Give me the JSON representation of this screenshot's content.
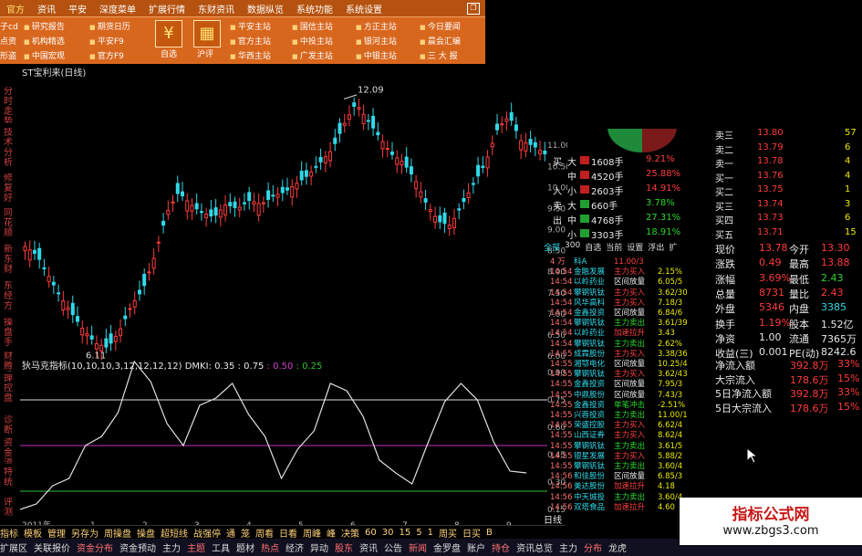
{
  "menu": {
    "top": [
      "官方",
      "资讯",
      "平安",
      "深度菜单",
      "扩展行情",
      "东财资讯",
      "数据纵览",
      "系统功能",
      "系统设置"
    ],
    "left_col": [
      "子cd",
      "点资",
      "形盗"
    ],
    "groups": [
      [
        "研究报告",
        "机构精选",
        "中国宏观"
      ],
      [
        "期货日历",
        "平安F9",
        "官方F9"
      ],
      [
        "平安主站",
        "官方主站",
        "华西主站"
      ],
      [
        "国信主站",
        "中投主站",
        "广发主站"
      ],
      [
        "方正主站",
        "银河主站",
        "中银主站"
      ],
      [
        "今日要闻",
        "晨会汇编",
        "三 大 报"
      ]
    ],
    "icon1": {
      "glyph": "¥",
      "label": "自选"
    },
    "icon2": {
      "glyph": "▦",
      "label": "沪评"
    }
  },
  "left_labels": [
    "分时走势",
    "技术分析",
    "修复好",
    "同花顺",
    "新东财",
    "东经方",
    "操盘手",
    "财腾手",
    "理财王",
    "控盘",
    "诊断",
    "资金流",
    "特统",
    "评测"
  ],
  "chart": {
    "title": "ST宝利来(日线)",
    "indicator_title": "狄马克指标(10,10,10,3,12,12,12,12)",
    "dmki_label": "DMKI: 0.35",
    "dmki_v2": ": 0.75",
    "dmki_v3": ": 0.50",
    "dmki_v4": ": 0.25",
    "high_label": "12.09",
    "low_label": "6.11",
    "x_ticks": [
      "2011年",
      "1",
      "2",
      "3",
      "4",
      "5",
      "6",
      "7",
      "8",
      "9"
    ],
    "y_ticks_price": [
      "11.00",
      "10.50",
      "10.00",
      "9.50",
      "9.00",
      "8.50",
      "8.00",
      "7.50",
      "7.00",
      "6.50",
      "6.00"
    ],
    "y_ticks_ind": [
      "0.90",
      "0.75",
      "0.60",
      "0.45",
      "0.30",
      "0.15"
    ],
    "period": "日线"
  },
  "chart_data": {
    "type": "line",
    "title": "ST宝利来(日线)",
    "series": [
      {
        "name": "price_close",
        "values": [
          8.6,
          8.4,
          7.9,
          7.4,
          7.0,
          6.6,
          6.3,
          6.2,
          6.6,
          7.2,
          7.6,
          8.4,
          9.4,
          9.9,
          9.6,
          9.4,
          9.3,
          9.6,
          9.5,
          9.7,
          9.6,
          9.8,
          9.9,
          10.1,
          10.3,
          10.6,
          10.9,
          11.5,
          12.0,
          11.6,
          11.2,
          10.8,
          10.6,
          10.2,
          9.6,
          9.2,
          9.1,
          9.6,
          10.1,
          10.6,
          11.4,
          11.7,
          11.1,
          11.0,
          10.8
        ]
      },
      {
        "name": "DMKI",
        "values": [
          0.15,
          0.18,
          0.28,
          0.32,
          0.5,
          0.55,
          0.68,
          0.96,
          0.85,
          0.62,
          0.5,
          0.72,
          0.76,
          0.84,
          0.67,
          0.55,
          0.32,
          0.48,
          0.58,
          0.84,
          0.8,
          0.66,
          0.42,
          0.35,
          0.29,
          0.52,
          0.74,
          0.84,
          0.75,
          0.52,
          0.36,
          0.35
        ]
      }
    ],
    "ylim_price": [
      6.0,
      12.5
    ],
    "ylim_ind": [
      0.1,
      0.95
    ],
    "ref_lines": [
      0.75,
      0.5,
      0.25
    ]
  },
  "quote": {
    "ask_rows": [
      [
        "卖三",
        "13.80",
        "57"
      ],
      [
        "卖二",
        "13.79",
        "6"
      ],
      [
        "卖一",
        "13.78",
        "4"
      ],
      [
        "买一",
        "13.76",
        "4"
      ],
      [
        "买二",
        "13.75",
        "1"
      ],
      [
        "买三",
        "13.74",
        "3"
      ],
      [
        "买四",
        "13.73",
        "6"
      ],
      [
        "买五",
        "13.71",
        "15"
      ]
    ],
    "flow_rows": [
      [
        "买",
        "大",
        "1608手",
        "9.21%"
      ],
      [
        "",
        "中",
        "4520手",
        "25.88%"
      ],
      [
        "入",
        "小",
        "2603手",
        "14.91%"
      ],
      [
        "卖",
        "大",
        "660手",
        "3.78%"
      ],
      [
        "出",
        "中",
        "4768手",
        "27.31%"
      ],
      [
        "",
        "小",
        "3303手",
        "18.91%"
      ]
    ],
    "tabs": [
      "全部",
      "300",
      "自选",
      "当前",
      "设置",
      "浮出",
      "扩"
    ],
    "stats": [
      [
        "现价",
        "13.78",
        "今开",
        "13.30"
      ],
      [
        "涨跌",
        "0.49",
        "最高",
        "13.88"
      ],
      [
        "涨幅",
        "3.69%",
        "最低",
        "2.43"
      ],
      [
        "总量",
        "8731",
        "量比",
        "2.43"
      ],
      [
        "外盘",
        "5346",
        "内盘",
        "3385"
      ],
      [
        "换手",
        "1.19%",
        "股本",
        "1.52亿"
      ],
      [
        "净资",
        "1.00",
        "流通",
        "7365万"
      ],
      [
        "收益(三)",
        "0.001",
        "PE(动)",
        "8242.6"
      ]
    ],
    "fund_flow": [
      [
        "净流入额",
        "392.8万",
        "33%"
      ],
      [
        "大宗流入",
        "178.6万",
        "15%"
      ],
      [
        "5日净流入额",
        "392.8万",
        "33%"
      ],
      [
        "5日大宗流入",
        "178.6万",
        "15%"
      ]
    ]
  },
  "ticker": [
    [
      "4 万",
      "科A",
      "11.00/3"
    ],
    [
      "14:54",
      "金融发展",
      "主力买入",
      "2.15%"
    ],
    [
      "14:54",
      "以岭药业",
      "区间放量",
      "6.05/5"
    ],
    [
      "14:54",
      "攀钢钒钛",
      "主力买入",
      "3.62/30"
    ],
    [
      "14:54",
      "风华高科",
      "主力买入",
      "7.18/3"
    ],
    [
      "14:54",
      "金鑫投资",
      "区间放量",
      "6.84/6"
    ],
    [
      "14:54",
      "攀钢钒钛",
      "主力卖出",
      "3.61/39"
    ],
    [
      "14:54",
      "以岭药业",
      "加速拉升",
      "3.43"
    ],
    [
      "14:54",
      "攀钢钒钛",
      "主力卖出",
      "2.62%"
    ],
    [
      "14:55",
      "成霖股份",
      "主力买入",
      "3.38/36"
    ],
    [
      "14:55",
      "湘鄂电化",
      "区间放量",
      "10.25/4"
    ],
    [
      "14:55",
      "攀钢钒钛",
      "主力买入",
      "3.62/43"
    ],
    [
      "14:55",
      "金鑫投资",
      "区间放量",
      "7.95/3"
    ],
    [
      "14:55",
      "中鼎股份",
      "区间放量",
      "7.43/3"
    ],
    [
      "14:55",
      "金鑫投资",
      "单笔冲击",
      "-2.51%"
    ],
    [
      "14:55",
      "兴蓉投资",
      "主力卖出",
      "11.00/1"
    ],
    [
      "14:55",
      "荣盛控股",
      "主力买入",
      "6.62/4"
    ],
    [
      "14:55",
      "山西证券",
      "主力买入",
      "8.62/4"
    ],
    [
      "14:55",
      "攀钢钒钛",
      "主力卖出",
      "3.61/5"
    ],
    [
      "14:55",
      "银星发展",
      "主力买入",
      "5.88/2"
    ],
    [
      "14:55",
      "攀钢钒钛",
      "主力卖出",
      "3.60/4"
    ],
    [
      "14:56",
      "和佳股份",
      "区间放量",
      "6.85/3"
    ],
    [
      "14:56",
      "美达股份",
      "加速拉升",
      "4.18"
    ],
    [
      "14:56",
      "中天城投",
      "主力卖出",
      "3.60/4"
    ],
    [
      "14:56",
      "双塔食品",
      "加速拉升",
      "4.60"
    ]
  ],
  "bottom_row1": [
    "指标",
    "模板",
    "管理",
    "另存为",
    "周操盘",
    "操盘",
    "超短线",
    "战强停",
    "通",
    "笼",
    "周看",
    "日看",
    "周峰",
    "峰",
    "决策",
    "60",
    "30",
    "15",
    "5",
    "1",
    "周买",
    "日买",
    "B"
  ],
  "bottom_row2": [
    "扩展区",
    "关联报价",
    "资金分布",
    "资金预动",
    "主力",
    "主题",
    "工具",
    "题材",
    "热点",
    "经济",
    "异动",
    "股东",
    "资讯",
    "公告",
    "新闻",
    "金罗盘",
    "账户",
    "持仓",
    "资讯总览",
    "主力",
    "分布",
    "龙虎"
  ],
  "watermark": {
    "line1": "指标公式网",
    "line2": "www.zbgs3.com"
  },
  "colors": {
    "up": "#ff3b3b",
    "down": "#30d8e8",
    "line75": "#e0e0e0",
    "line50": "#c030c0",
    "line25": "#30c030"
  }
}
